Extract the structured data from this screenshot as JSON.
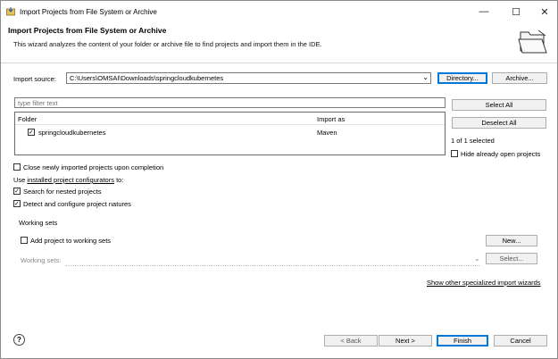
{
  "window": {
    "title": "Import Projects from File System or Archive",
    "minimize_glyph": "—",
    "maximize_glyph": "☐",
    "close_glyph": "✕"
  },
  "header": {
    "title": "Import Projects from File System or Archive",
    "description": "This wizard analyzes the content of your folder or archive file to find projects and import them in the IDE."
  },
  "source": {
    "label": "Import source:",
    "value": "C:\\Users\\OMSAI\\Downloads\\springcloudkubernetes",
    "directory_button": "Directory...",
    "archive_button": "Archive..."
  },
  "filter": {
    "placeholder": "type filter text"
  },
  "table": {
    "columns": [
      "Folder",
      "Import as"
    ],
    "rows": [
      {
        "folder": "springcloudkubernetes",
        "import_as": "Maven",
        "checked": true
      }
    ]
  },
  "side": {
    "select_all": "Select All",
    "deselect_all": "Deselect All",
    "selected_count": "1 of 1 selected",
    "hide_open_projects": "Hide already open projects"
  },
  "options": {
    "close_on_completion": "Close newly imported projects upon completion",
    "use_prefix": "Use ",
    "configurators_link": "installed project configurators",
    "use_suffix": " to:",
    "search_nested": "Search for nested projects",
    "detect_configure": "Detect and configure project natures"
  },
  "working_sets": {
    "group_label": "Working sets",
    "add_label": "Add project to working sets",
    "new_button": "New...",
    "sets_label": "Working sets:",
    "select_button": "Select..."
  },
  "footer": {
    "specialized_link": "Show other specialized import wizards",
    "back": "< Back",
    "next": "Next >",
    "finish": "Finish",
    "cancel": "Cancel",
    "help_glyph": "?"
  },
  "icons": {
    "app": "import-icon",
    "help": "help-icon",
    "folder": "open-folder-icon"
  }
}
